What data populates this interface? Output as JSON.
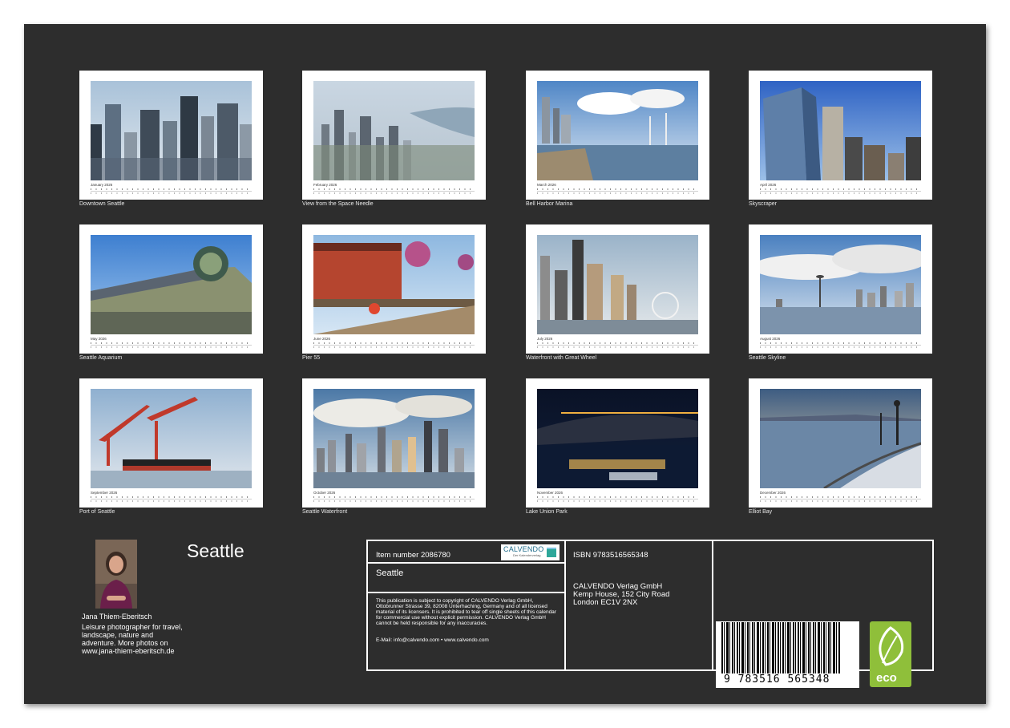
{
  "months": [
    {
      "name": "January 2026",
      "caption": "Downtown Seattle",
      "scene": "downtown"
    },
    {
      "name": "February 2026",
      "caption": "View from the Space Needle",
      "scene": "aerial"
    },
    {
      "name": "March 2026",
      "caption": "Bell Harbor Marina",
      "scene": "marina"
    },
    {
      "name": "April 2026",
      "caption": "Skyscraper",
      "scene": "skyscraper"
    },
    {
      "name": "May 2026",
      "caption": "Seattle Aquarium",
      "scene": "aquarium"
    },
    {
      "name": "June 2026",
      "caption": "Pier 55",
      "scene": "pier"
    },
    {
      "name": "July 2026",
      "caption": "Waterfront with Great Wheel",
      "scene": "wheel"
    },
    {
      "name": "August 2026",
      "caption": "Seattle Skyline",
      "scene": "skyline"
    },
    {
      "name": "September 2026",
      "caption": "Port of Seattle",
      "scene": "port"
    },
    {
      "name": "October 2026",
      "caption": "Seattle Waterfront",
      "scene": "waterfront"
    },
    {
      "name": "November 2026",
      "caption": "Lake Union Park",
      "scene": "night"
    },
    {
      "name": "December 2026",
      "caption": "Elliot Bay",
      "scene": "bay"
    }
  ],
  "author": {
    "name": "Jana Thiem-Eberitsch",
    "bio": "Leisure photographer for travel, landscape, nature and adventure. More photos on www.jana-thiem-eberitsch.de"
  },
  "calendar_title": "Seattle",
  "info": {
    "item_number": "Item number 2086780",
    "subtitle": "Seattle",
    "legal": "This publication is subject to copyright of CALVENDO Verlag GmbH, Ottobrunner Strasse 39, 82008 Unterhaching, Germany and of all licensed material of its licensers. It is prohibited to tear off single sheets of this calendar for commercial use without explicit permission. CALVENDO Verlag GmbH cannot be held responsible for any inaccuracies.",
    "contact": "E-Mail: info@calvendo.com • www.calvendo.com",
    "isbn": "ISBN 9783516565348",
    "publisher": [
      "CALVENDO Verlag GmbH",
      "Kemp House, 152 City Road",
      "London EC1V 2NX"
    ],
    "logo_word": "CALVENDO",
    "logo_tagline": "Der Kalenderverlag",
    "barcode_digits": "9 783516 565348",
    "eco_label": "eco"
  },
  "colors": {
    "background": "#2d2d2d",
    "card": "#ffffff",
    "text": "#ffffff",
    "eco": "#8fbf3a"
  }
}
